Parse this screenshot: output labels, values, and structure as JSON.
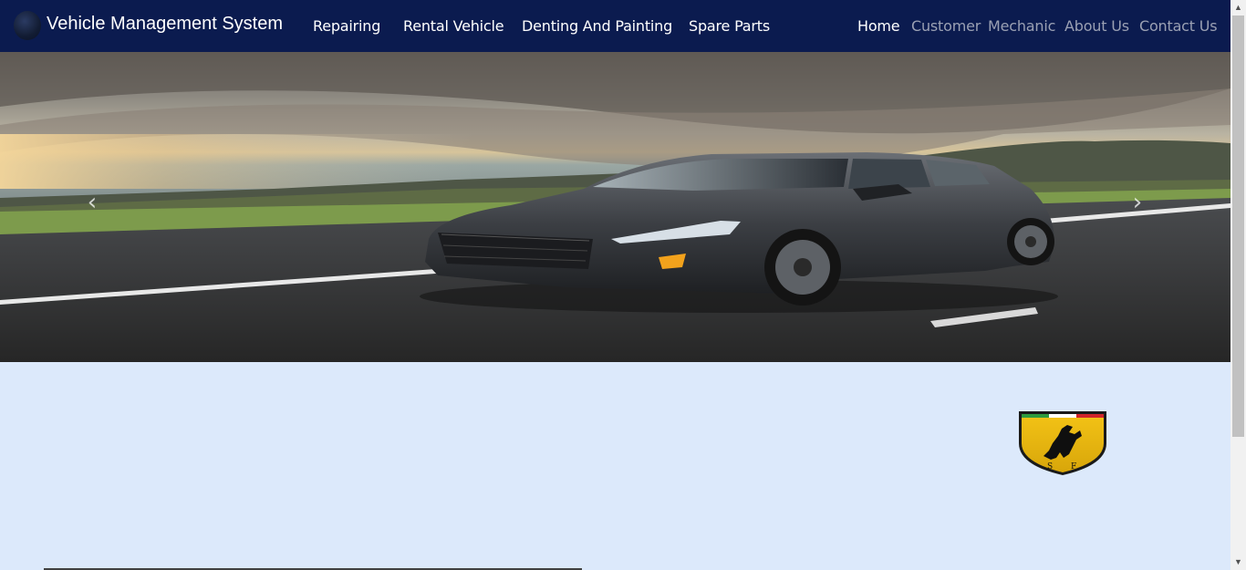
{
  "brand": {
    "title": "Vehicle Management System",
    "logo_icon": "globe-logo-icon"
  },
  "nav_left": [
    {
      "label": "Repairing"
    },
    {
      "label": "Rental Vehicle"
    },
    {
      "label": "Denting And Painting"
    },
    {
      "label": "Spare Parts"
    }
  ],
  "nav_right": [
    {
      "label": "Home",
      "active": true
    },
    {
      "label": "Customer",
      "active": false
    },
    {
      "label": "Mechanic",
      "active": false
    },
    {
      "label": "About Us",
      "active": false
    },
    {
      "label": "Contact Us",
      "active": false
    }
  ],
  "carousel": {
    "prev_icon": "chevron-left-icon",
    "next_icon": "chevron-right-icon",
    "prev_glyph": "‹",
    "next_glyph": "›"
  },
  "colors": {
    "navbar": "#0b1b4f",
    "page_bg": "#dce9fb",
    "nav_inactive": "#9aa0b3"
  },
  "scrollbar": {
    "up_glyph": "▲",
    "down_glyph": "▼"
  }
}
